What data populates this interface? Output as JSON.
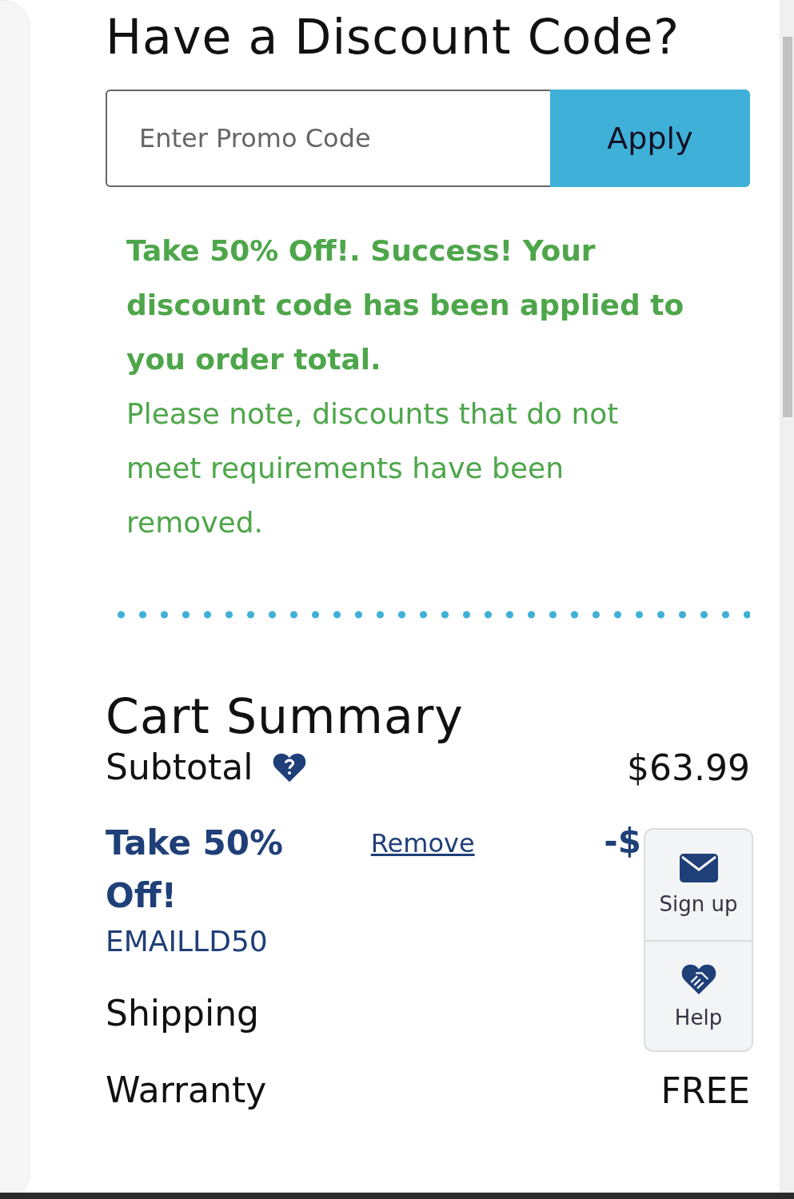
{
  "discount": {
    "title": "Have a Discount Code?",
    "promo_field": {
      "placeholder": "Enter Promo Code"
    },
    "apply_button": "Apply",
    "success_message": "Take 50% Off!. Success! Your discount code has been applied to you order total.",
    "note": "Please note, discounts that do not meet requirements have been removed."
  },
  "cart_summary": {
    "title": "Cart Summary",
    "subtotal": {
      "label": "Subtotal",
      "value": "$63.99"
    },
    "applied_discount": {
      "name": "Take 50% Off!",
      "remove_link": "Remove",
      "code": "EMAILLD50",
      "value": "-$"
    },
    "rows": [
      {
        "label": "Shipping"
      },
      {
        "label": "Warranty",
        "value": "FREE"
      }
    ]
  },
  "floating_widget": {
    "items": [
      {
        "kind": "mail",
        "label": "Sign up"
      },
      {
        "kind": "help",
        "label": "Help"
      }
    ]
  }
}
